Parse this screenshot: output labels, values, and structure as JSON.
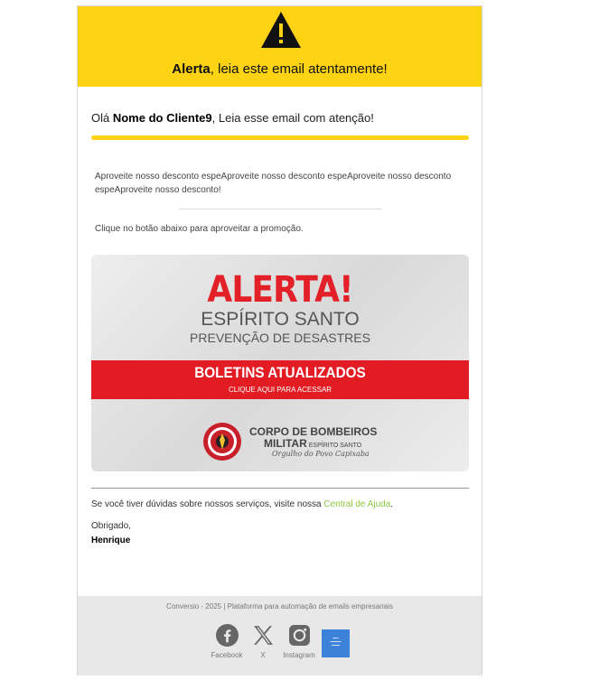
{
  "header": {
    "title_bold": "Alerta",
    "title_rest": ", leia este email atentamente!",
    "colors": {
      "brand_yellow": "#fdd314"
    }
  },
  "greeting": {
    "prefix": "Olá ",
    "name": "Nome do Cliente9",
    "suffix": ", Leia esse email com atenção!"
  },
  "body": {
    "promo_text": "Aproveite nosso desconto espeAproveite nosso desconto espeAproveite nosso desconto espeAproveite nosso desconto!",
    "cta_text": "Clique no botão abaixo para aproveitar a promoção."
  },
  "banner": {
    "alerta": "ALERTA!",
    "state": "ESPÍRITO SANTO",
    "prevention": "PREVENÇÃO DE DESASTRES",
    "boletins": "BOLETINS ATUALIZADOS",
    "clique": "CLIQUE AQUI PARA ACESSAR",
    "cb_line1": "CORPO DE BOMBEIROS",
    "cb_line2": "MILITAR",
    "cb_small": "ESPÍRITO SANTO",
    "cb_motto": "Orgulho do Povo Capixaba",
    "colors": {
      "red": "#e31b23"
    }
  },
  "help": {
    "prefix": "Se você tiver dúvidas sobre nossos serviços, visite nossa ",
    "link": "Central de Ajuda",
    "suffix": ".",
    "link_color": "#8dc63f"
  },
  "closing": {
    "thanks": "Obrigado,",
    "signature": "Henrique"
  },
  "footer": {
    "text": "Conversio - 2025 | Plataforma para automação de emails empresariais",
    "social": [
      {
        "label": "Facebook",
        "icon": "facebook-icon"
      },
      {
        "label": "X",
        "icon": "x-icon"
      },
      {
        "label": "Instagram",
        "icon": "instagram-icon"
      }
    ]
  }
}
